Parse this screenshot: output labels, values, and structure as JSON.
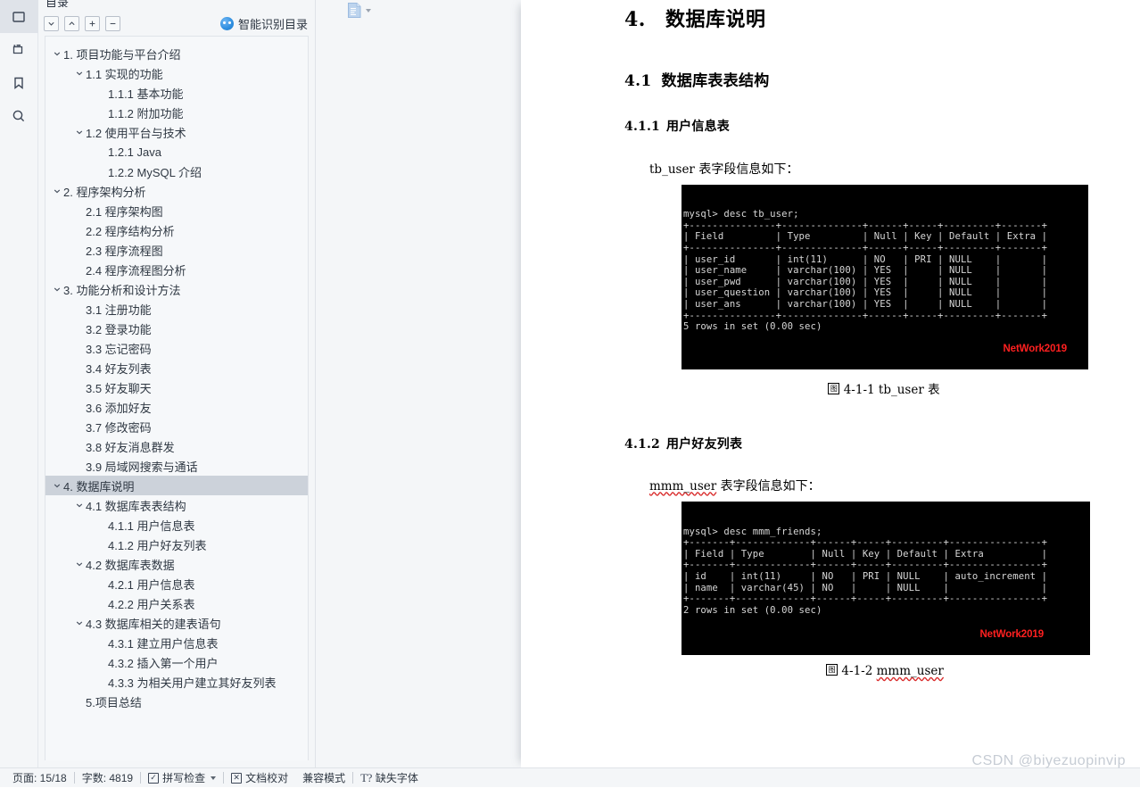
{
  "rail": {
    "items": [
      {
        "name": "panel-icon",
        "label": "面板",
        "active": true
      },
      {
        "name": "outline-icon",
        "label": "目录大纲",
        "active": false
      },
      {
        "name": "bookmark-icon",
        "label": "书签",
        "active": false
      },
      {
        "name": "search-icon",
        "label": "查找",
        "active": false
      }
    ]
  },
  "toc": {
    "title": "目录",
    "toolbar": [
      {
        "name": "collapse-down-button",
        "glyph": "chevron-down"
      },
      {
        "name": "collapse-up-button",
        "glyph": "chevron-up"
      },
      {
        "name": "expand-all-button",
        "glyph": "plus"
      },
      {
        "name": "collapse-all-button",
        "glyph": "minus"
      }
    ],
    "smart_toc_label": "智能识别目录",
    "items": [
      {
        "label": "1. 项目功能与平台介绍",
        "indent": 0,
        "caret": true,
        "selected": false
      },
      {
        "label": "1.1 实现的功能",
        "indent": 1,
        "caret": true,
        "selected": false
      },
      {
        "label": "1.1.1 基本功能",
        "indent": 2,
        "caret": false,
        "selected": false
      },
      {
        "label": "1.1.2 附加功能",
        "indent": 2,
        "caret": false,
        "selected": false
      },
      {
        "label": "1.2 使用平台与技术",
        "indent": 1,
        "caret": true,
        "selected": false
      },
      {
        "label": "1.2.1 Java",
        "indent": 2,
        "caret": false,
        "selected": false
      },
      {
        "label": "1.2.2 MySQL 介绍",
        "indent": 2,
        "caret": false,
        "selected": false
      },
      {
        "label": "2. 程序架构分析",
        "indent": 0,
        "caret": true,
        "selected": false
      },
      {
        "label": "2.1 程序架构图",
        "indent": 1,
        "caret": false,
        "selected": false
      },
      {
        "label": "2.2 程序结构分析",
        "indent": 1,
        "caret": false,
        "selected": false
      },
      {
        "label": "2.3 程序流程图",
        "indent": 1,
        "caret": false,
        "selected": false
      },
      {
        "label": "2.4 程序流程图分析",
        "indent": 1,
        "caret": false,
        "selected": false
      },
      {
        "label": "3. 功能分析和设计方法",
        "indent": 0,
        "caret": true,
        "selected": false
      },
      {
        "label": "3.1 注册功能",
        "indent": 1,
        "caret": false,
        "selected": false
      },
      {
        "label": "3.2 登录功能",
        "indent": 1,
        "caret": false,
        "selected": false
      },
      {
        "label": "3.3 忘记密码",
        "indent": 1,
        "caret": false,
        "selected": false
      },
      {
        "label": "3.4 好友列表",
        "indent": 1,
        "caret": false,
        "selected": false
      },
      {
        "label": "3.5 好友聊天",
        "indent": 1,
        "caret": false,
        "selected": false
      },
      {
        "label": "3.6 添加好友",
        "indent": 1,
        "caret": false,
        "selected": false
      },
      {
        "label": "3.7 修改密码",
        "indent": 1,
        "caret": false,
        "selected": false
      },
      {
        "label": "3.8 好友消息群发",
        "indent": 1,
        "caret": false,
        "selected": false
      },
      {
        "label": "3.9 局域网搜索与通话",
        "indent": 1,
        "caret": false,
        "selected": false
      },
      {
        "label": "4. 数据库说明",
        "indent": 0,
        "caret": true,
        "selected": true
      },
      {
        "label": "4.1 数据库表表结构",
        "indent": 1,
        "caret": true,
        "selected": false
      },
      {
        "label": "4.1.1 用户信息表",
        "indent": 2,
        "caret": false,
        "selected": false
      },
      {
        "label": "4.1.2 用户好友列表",
        "indent": 2,
        "caret": false,
        "selected": false
      },
      {
        "label": "4.2 数据库表数据",
        "indent": 1,
        "caret": true,
        "selected": false
      },
      {
        "label": "4.2.1 用户信息表",
        "indent": 2,
        "caret": false,
        "selected": false
      },
      {
        "label": "4.2.2 用户关系表",
        "indent": 2,
        "caret": false,
        "selected": false
      },
      {
        "label": "4.3 数据库相关的建表语句",
        "indent": 1,
        "caret": true,
        "selected": false
      },
      {
        "label": "4.3.1 建立用户信息表",
        "indent": 2,
        "caret": false,
        "selected": false
      },
      {
        "label": "4.3.2 插入第一个用户",
        "indent": 2,
        "caret": false,
        "selected": false
      },
      {
        "label": "4.3.3 为相关用户建立其好友列表",
        "indent": 2,
        "caret": false,
        "selected": false
      },
      {
        "label": "5.项目总结",
        "indent": 1,
        "caret": false,
        "selected": false
      }
    ]
  },
  "document": {
    "h1_num": "4.",
    "h1_text": "数据库说明",
    "s41_num": "4.1",
    "s41_text": "数据库表表结构",
    "s411_num": "4.1.1",
    "s411_text": "用户信息表",
    "p411_code": "tb_user",
    "p411_rest": " 表字段信息如下：",
    "figure1_caption_num": " 4-1-1 tb_user ",
    "figure1_caption_tail": "表",
    "s412_num": "4.1.2",
    "s412_text": "用户好友列表",
    "p412_code": "mmm_user",
    "p412_rest": " 表字段信息如下：",
    "figure2_caption_num": " 4-1-2 ",
    "figure2_caption_code": "mmm_user",
    "terminal1": {
      "lines": [
        "mysql> desc tb_user;",
        "+---------------+--------------+------+-----+---------+-------+",
        "| Field         | Type         | Null | Key | Default | Extra |",
        "+---------------+--------------+------+-----+---------+-------+",
        "| user_id       | int(11)      | NO   | PRI | NULL    |       |",
        "| user_name     | varchar(100) | YES  |     | NULL    |       |",
        "| user_pwd      | varchar(100) | YES  |     | NULL    |       |",
        "| user_question | varchar(100) | YES  |     | NULL    |       |",
        "| user_ans      | varchar(100) | YES  |     | NULL    |       |",
        "+---------------+--------------+------+-----+---------+-------+",
        "5 rows in set (0.00 sec)"
      ],
      "watermark": "NetWork2019"
    },
    "terminal2": {
      "lines": [
        "mysql> desc mmm_friends;",
        "+-------+-------------+------+-----+---------+----------------+",
        "| Field | Type        | Null | Key | Default | Extra          |",
        "+-------+-------------+------+-----+---------+----------------+",
        "| id    | int(11)     | NO   | PRI | NULL    | auto_increment |",
        "| name  | varchar(45) | NO   |     | NULL    |                |",
        "+-------+-------------+------+-----+---------+----------------+",
        "2 rows in set (0.00 sec)"
      ],
      "watermark": "NetWork2019"
    }
  },
  "statusbar": {
    "page_label": "页面: 15/18",
    "word_count_label": "字数: 4819",
    "spellcheck_label": "拼写检查",
    "proofread_label": "文档校对",
    "compat_label": "兼容模式",
    "missing_font_label": "缺失字体"
  },
  "watermark": "CSDN @biyezuopinvip",
  "colors": {
    "panel_bg": "#f4f6f8",
    "selected_row": "#ccd2da",
    "accent_blue": "#2f8fe0",
    "terminal_bg": "#000000",
    "terminal_watermark": "#ff2020",
    "page_watermark": "#c6ccd4"
  }
}
